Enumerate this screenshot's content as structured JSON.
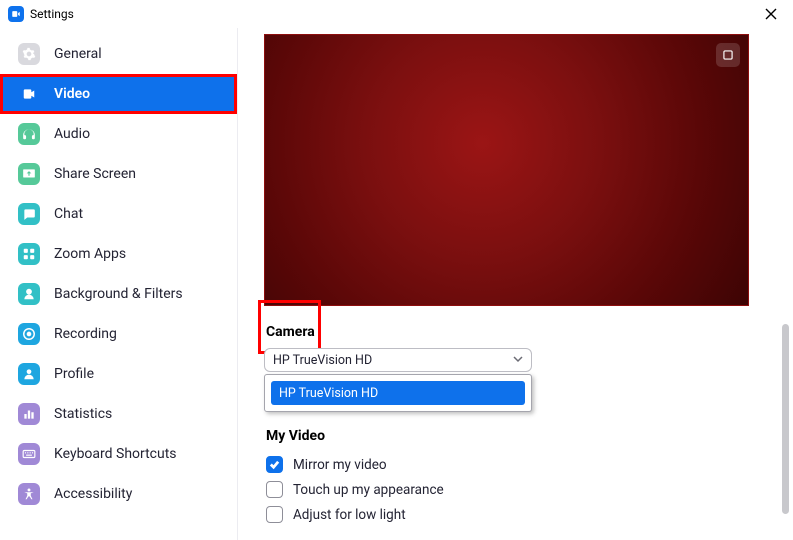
{
  "titlebar": {
    "title": "Settings"
  },
  "sidebar": {
    "items": [
      {
        "label": "General"
      },
      {
        "label": "Video"
      },
      {
        "label": "Audio"
      },
      {
        "label": "Share Screen"
      },
      {
        "label": "Chat"
      },
      {
        "label": "Zoom Apps"
      },
      {
        "label": "Background & Filters"
      },
      {
        "label": "Recording"
      },
      {
        "label": "Profile"
      },
      {
        "label": "Statistics"
      },
      {
        "label": "Keyboard Shortcuts"
      },
      {
        "label": "Accessibility"
      }
    ]
  },
  "main": {
    "camera": {
      "title": "Camera",
      "selected": "HP TrueVision HD",
      "options": [
        "HP TrueVision HD"
      ]
    },
    "myvideo": {
      "title": "My Video",
      "mirror": "Mirror my video",
      "touchup": "Touch up my appearance",
      "lowlight": "Adjust for low light"
    }
  }
}
